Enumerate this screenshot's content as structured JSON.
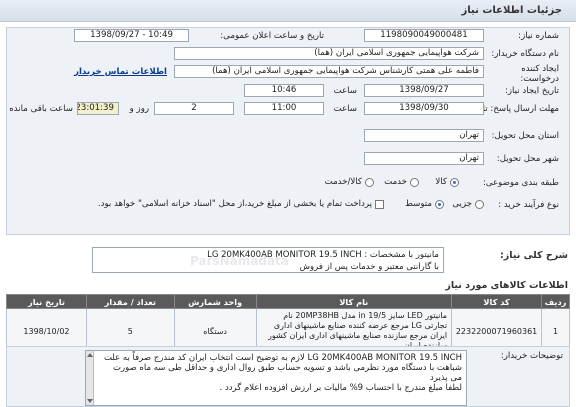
{
  "header": {
    "title": "جزئیات اطلاعات نیاز"
  },
  "form": {
    "need_number_label": "شماره نیاز:",
    "need_number": "1198090049000481",
    "announce_datetime_label": "تاریخ و ساعت اعلان عمومی:",
    "announce_datetime": "1398/09/27 - 10:49",
    "buyer_org_label": "نام دستگاه خریدار:",
    "buyer_org": "شرکت هواپیمایی جمهوری اسلامی ایران (هما)",
    "requester_label": "ایجاد کننده درخواست:",
    "requester": "فاطمه علی همتی کارشناس شرکت هواپیمایی جمهوری اسلامی ایران (هما)",
    "buyer_contact_link": "اطلاعات تماس خریدار",
    "need_date_label": "تاریخ ایجاد نیاز:",
    "need_date": "1398/09/27",
    "need_time_label": "ساعت",
    "need_time": "10:46",
    "deadline_label": "مهلت ارسال پاسخ: تا تاریخ:",
    "deadline_date": "1398/09/30",
    "deadline_time_label": "ساعت",
    "deadline_time": "11:00",
    "days": "2",
    "days_label": "روز و",
    "remaining": "23:01:39",
    "remaining_label": "ساعت باقی مانده",
    "province_label": "استان محل تحویل:",
    "province": "تهران",
    "city_label": "شهر محل تحویل:",
    "city": "تهران",
    "category_label": "طبقه بندی موضوعی:",
    "category_options": [
      "کالا",
      "خدمت",
      "کالا/خدمت"
    ],
    "purchase_type_label": "نوع فرآیند خرید :",
    "purchase_options": [
      "جزیی",
      "متوسط"
    ],
    "payment_note": "پرداخت تمام یا بخشی از مبلغ خرید،از محل \"اسناد خزانه اسلامی\" خواهد بود."
  },
  "general_description": {
    "label": "شرح کلی نیاز:",
    "text": "مانیتور با مشخصات : LG 20MK400AB MONITOR 19.5 INCH\nبا گارانتی معتبر و خدمات پس از فروش"
  },
  "goods_section": {
    "title": "اطلاعات کالاهای مورد نیاز"
  },
  "table": {
    "headers": [
      "ردیف",
      "کد کالا",
      "نام کالا",
      "واحد شمارش",
      "تعداد / مقدار",
      "تاریخ نیاز"
    ],
    "rows": [
      {
        "row": "1",
        "code": "2232200071960361",
        "name": "مانیتور LED سایز in 19/5 مدل 20MP38HB نام تجارتی LG مرجع عرضه کننده صنایع ماشینهای اداری ایران مرجع سازنده صنایع ماشینهای اداری ایران کشور سازنده ایران",
        "unit": "دستگاه",
        "qty": "5",
        "date": "1398/10/02"
      }
    ]
  },
  "notes": {
    "label": "توضیحات خریدار:",
    "text": "LG 20MK400AB MONITOR 19.5 INCH لازم به توضیح است انتخاب ایران کد مندرج صرفاً به علت شباهت با دستگاه مورد نظرمی باشد و تسویه حساب طبق روال اداری و حداقل طی سه ماه صورت می پذیرد\nلطفا مبلغ مندرج با احتساب 9% مالیات بر ارزش افزوده اعلام گردد ."
  },
  "watermark": "ParsNamadata"
}
